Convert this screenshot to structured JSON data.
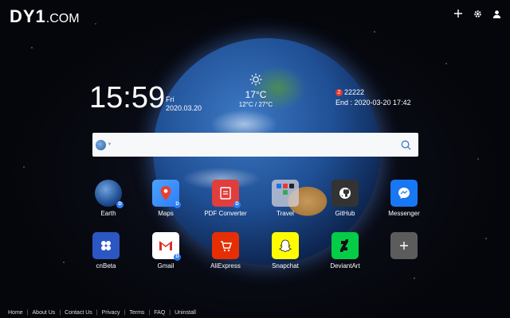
{
  "header": {
    "logo_main": "DY1",
    "logo_suffix": ".COM",
    "actions": [
      {
        "icon": "plus-icon",
        "glyph": "+"
      },
      {
        "icon": "gear-icon",
        "glyph": "⚙"
      },
      {
        "icon": "user-icon",
        "glyph": "●"
      }
    ]
  },
  "clock": {
    "time": "15:59",
    "weekday": "Fri",
    "date": "2020.03.20"
  },
  "weather": {
    "icon": "sun-icon",
    "temp": "17°C",
    "range": "12°C / 27°C"
  },
  "countdown": {
    "badge": "2",
    "title": "22222",
    "end": "End : 2020-03-20 17:42"
  },
  "search": {
    "engine_icon": "globe-icon",
    "value": "",
    "placeholder": ""
  },
  "apps": [
    {
      "label": "Earth",
      "icon": "earth-icon",
      "color": "#2a5fa8"
    },
    {
      "label": "Maps",
      "icon": "maps-icon",
      "color": "#2f7df6"
    },
    {
      "label": "PDF Converter",
      "icon": "pdf-icon",
      "color": "#e03d3d"
    },
    {
      "label": "Travel",
      "icon": "folder-icon",
      "color": "#c9c9c9"
    },
    {
      "label": "GitHub",
      "icon": "github-icon",
      "color": "#333333"
    },
    {
      "label": "Messenger",
      "icon": "messenger-icon",
      "color": "#1877f2"
    },
    {
      "label": "cnBeta",
      "icon": "cnbeta-icon",
      "color": "#2c56c2"
    },
    {
      "label": "Gmail",
      "icon": "gmail-icon",
      "color": "#ffffff"
    },
    {
      "label": "AliExpress",
      "icon": "aliexpress-icon",
      "color": "#e62e04"
    },
    {
      "label": "Snapchat",
      "icon": "snapchat-icon",
      "color": "#fffc00"
    },
    {
      "label": "DeviantArt",
      "icon": "deviantart-icon",
      "color": "#05cc47"
    },
    {
      "label": "",
      "icon": "add-icon",
      "color": "#666666"
    }
  ],
  "footer": {
    "links": [
      "Home",
      "About Us",
      "Contact Us",
      "Privacy",
      "Terms",
      "FAQ",
      "Uninstall"
    ]
  }
}
